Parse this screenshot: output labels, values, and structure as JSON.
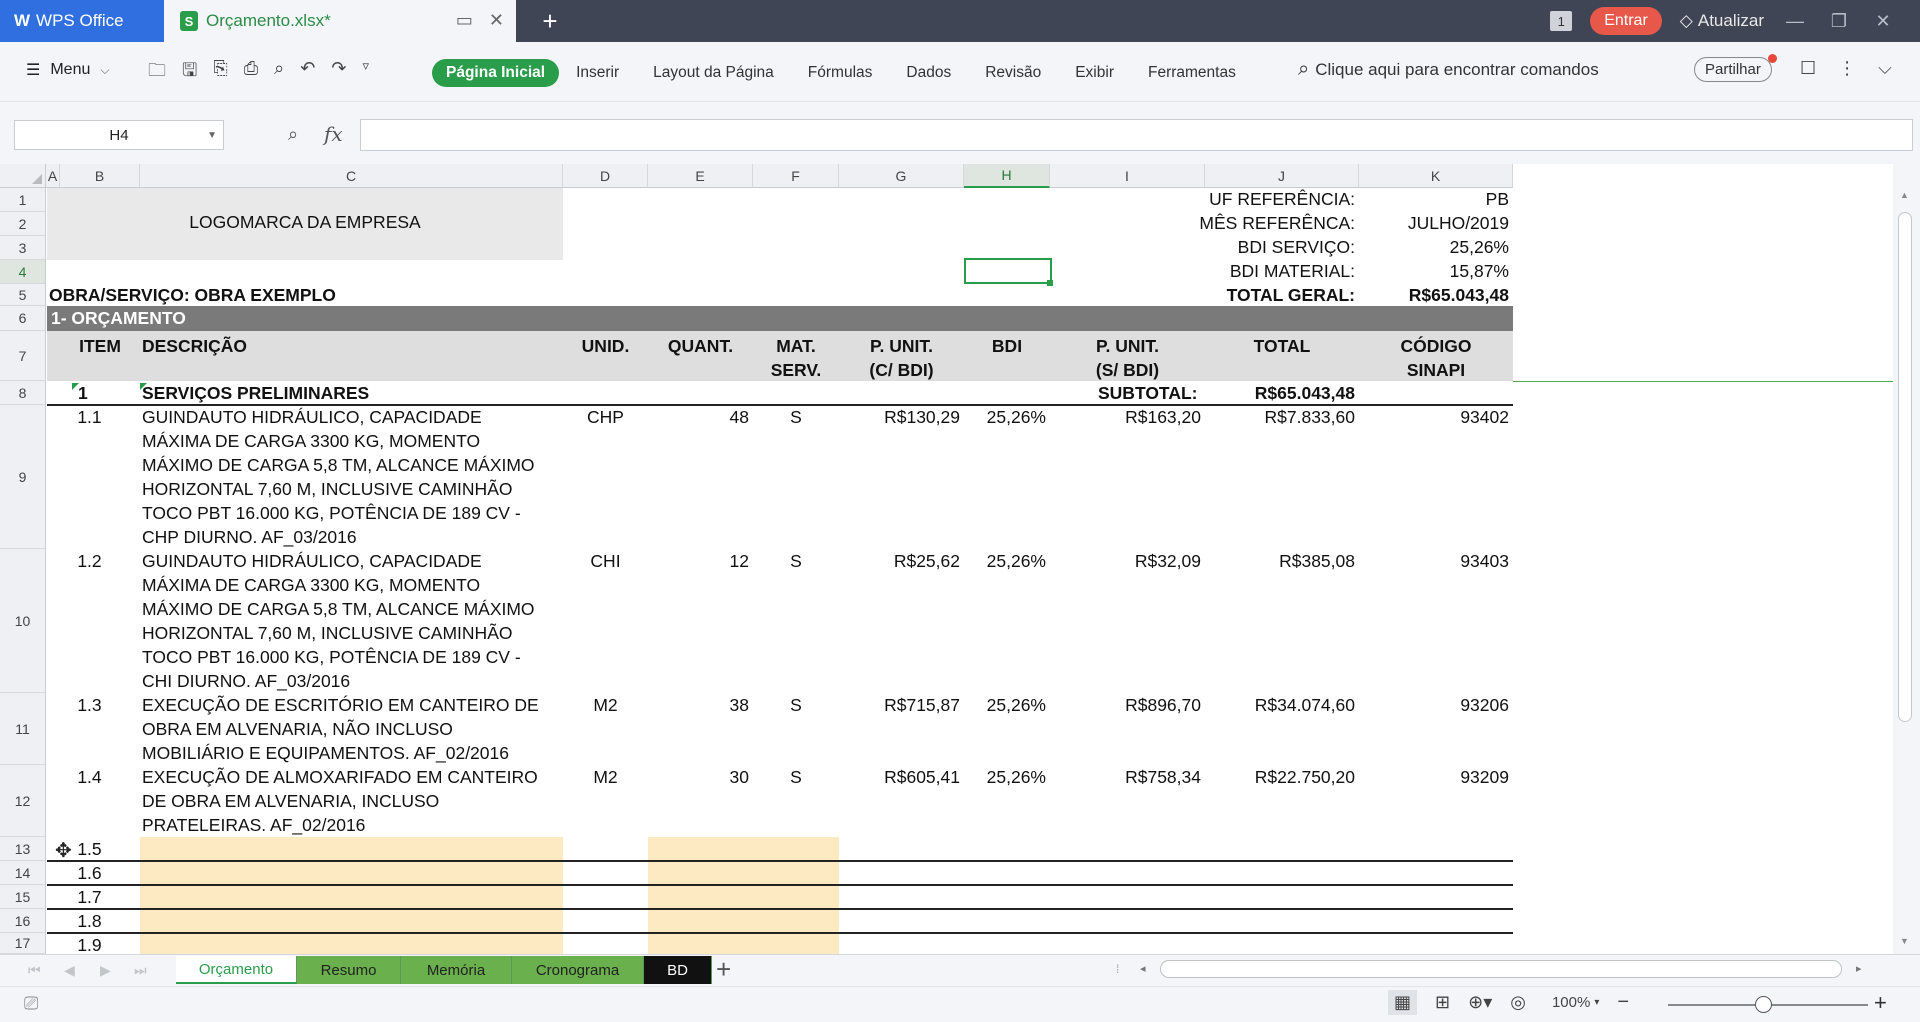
{
  "titlebar": {
    "app_tab": "WPS Office",
    "file_tab": "Orçamento.xlsx*",
    "entrar": "Entrar",
    "atualizar": "Atualizar",
    "window_count": "1"
  },
  "ribbon": {
    "menu": "Menu",
    "tabs": [
      "Página Inicial",
      "Inserir",
      "Layout da Página",
      "Fórmulas",
      "Dados",
      "Revisão",
      "Exibir",
      "Ferramentas"
    ],
    "search": "Clique aqui para encontrar comandos",
    "share": "Partilhar"
  },
  "formula_bar": {
    "name_box": "H4",
    "fx": "fx",
    "content": ""
  },
  "columns": [
    "A",
    "B",
    "C",
    "D",
    "E",
    "F",
    "G",
    "H",
    "I",
    "J",
    "K"
  ],
  "rows": [
    "1",
    "2",
    "3",
    "4",
    "5",
    "6",
    "7",
    "8",
    "9",
    "10",
    "11",
    "12",
    "13",
    "14",
    "15",
    "16",
    "17"
  ],
  "sheet": {
    "logo": "LOGOMARCA DA EMPRESA",
    "ref": {
      "uf_label": "UF REFERÊNCIA:",
      "uf_value": "PB",
      "mes_label": "MÊS REFERÊNCA:",
      "mes_value": "JULHO/2019",
      "bdi_serv_label": "BDI SERVIÇO:",
      "bdi_serv_value": "25,26%",
      "bdi_mat_label": "BDI MATERIAL:",
      "bdi_mat_value": "15,87%",
      "total_label": "TOTAL GERAL:",
      "total_value": "R$65.043,48"
    },
    "obra": "OBRA/SERVIÇO: OBRA EXEMPLO",
    "section": "1-  ORÇAMENTO",
    "headers": {
      "item": "ITEM",
      "descricao": "DESCRIÇÃO",
      "unid": "UNID.",
      "quant": "QUANT.",
      "mat_1": "MAT.",
      "mat_2": "SERV.",
      "punit_c_1": "P. UNIT.",
      "punit_c_2": "(C/ BDI)",
      "bdi": "BDI",
      "punit_s_1": "P. UNIT.",
      "punit_s_2": "(S/ BDI)",
      "total": "TOTAL",
      "codigo_1": "CÓDIGO",
      "codigo_2": "SINAPI"
    },
    "group": {
      "item": "1",
      "desc": "SERVIÇOS PRELIMINARES",
      "subtotal_label": "SUBTOTAL:",
      "subtotal_value": "R$65.043,48"
    },
    "items": [
      {
        "item": "1.1",
        "desc": [
          "GUINDAUTO HIDRÁULICO, CAPACIDADE",
          "MÁXIMA DE CARGA 3300 KG, MOMENTO",
          "MÁXIMO DE CARGA 5,8 TM, ALCANCE MÁXIMO",
          "HORIZONTAL 7,60 M, INCLUSIVE CAMINHÃO",
          "TOCO PBT 16.000 KG, POTÊNCIA DE 189 CV -",
          "CHP DIURNO. AF_03/2016"
        ],
        "unid": "CHP",
        "quant": "48",
        "mat": "S",
        "punit_c": "R$130,29",
        "bdi": "25,26%",
        "punit_s": "R$163,20",
        "total": "R$7.833,60",
        "codigo": "93402"
      },
      {
        "item": "1.2",
        "desc": [
          "GUINDAUTO HIDRÁULICO, CAPACIDADE",
          "MÁXIMA DE CARGA 3300 KG, MOMENTO",
          "MÁXIMO DE CARGA 5,8 TM, ALCANCE MÁXIMO",
          "HORIZONTAL 7,60 M, INCLUSIVE CAMINHÃO",
          "TOCO PBT 16.000 KG, POTÊNCIA DE 189 CV -",
          "CHI DIURNO. AF_03/2016"
        ],
        "unid": "CHI",
        "quant": "12",
        "mat": "S",
        "punit_c": "R$25,62",
        "bdi": "25,26%",
        "punit_s": "R$32,09",
        "total": "R$385,08",
        "codigo": "93403"
      },
      {
        "item": "1.3",
        "desc": [
          "EXECUÇÃO DE ESCRITÓRIO EM CANTEIRO DE",
          "OBRA EM ALVENARIA, NÃO INCLUSO",
          "MOBILIÁRIO E EQUIPAMENTOS. AF_02/2016"
        ],
        "unid": "M2",
        "quant": "38",
        "mat": "S",
        "punit_c": "R$715,87",
        "bdi": "25,26%",
        "punit_s": "R$896,70",
        "total": "R$34.074,60",
        "codigo": "93206"
      },
      {
        "item": "1.4",
        "desc": [
          "EXECUÇÃO DE ALMOXARIFADO EM CANTEIRO",
          "DE OBRA EM ALVENARIA, INCLUSO",
          "PRATELEIRAS. AF_02/2016"
        ],
        "unid": "M2",
        "quant": "30",
        "mat": "S",
        "punit_c": "R$605,41",
        "bdi": "25,26%",
        "punit_s": "R$758,34",
        "total": "R$22.750,20",
        "codigo": "93209"
      }
    ],
    "empty_items": [
      "1.5",
      "1.6",
      "1.7",
      "1.8",
      "1.9"
    ]
  },
  "sheet_tabs": [
    "Orçamento",
    "Resumo",
    "Memória",
    "Cronograma",
    "BD"
  ],
  "status": {
    "zoom": "100%"
  }
}
